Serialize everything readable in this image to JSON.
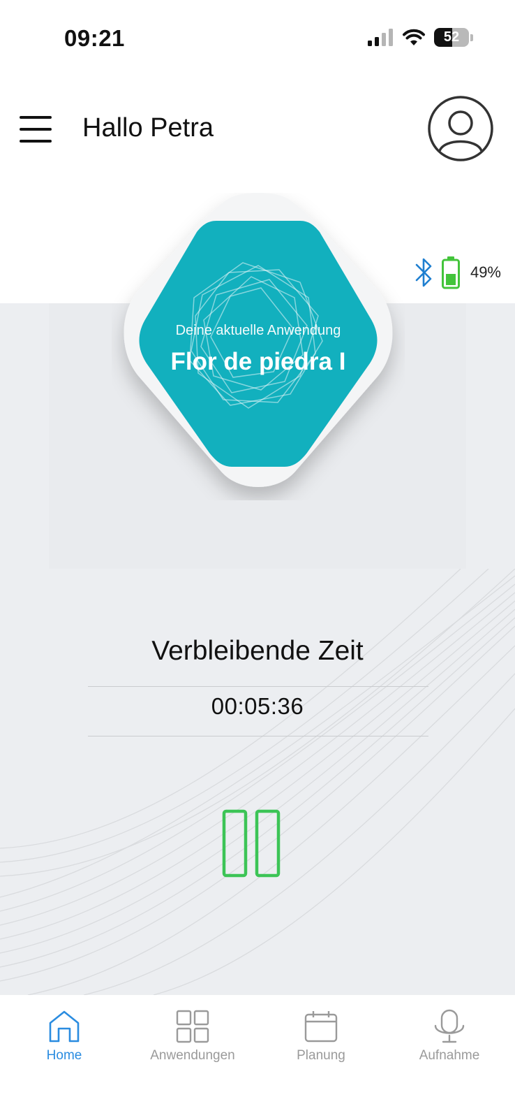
{
  "status_bar": {
    "time": "09:21",
    "battery_level": "52"
  },
  "header": {
    "greeting": "Hallo Petra",
    "menu_icon": "hamburger-icon",
    "profile_icon": "user-avatar-icon"
  },
  "device": {
    "bluetooth_icon": "bluetooth-icon",
    "battery_icon": "battery-icon",
    "battery_percent": "49%",
    "battery_color": "#43c43b"
  },
  "current_application": {
    "subtitle": "Deine aktuelle Anwendung",
    "title": "Flor de piedra I",
    "accent_color": "#12b0be"
  },
  "timer": {
    "label": "Verbleibende Zeit",
    "value": "00:05:36"
  },
  "controls": {
    "pause_icon": "pause-icon",
    "pause_color": "#3cc456"
  },
  "tabbar": {
    "tabs": [
      {
        "label": "Home",
        "icon": "home-icon",
        "active": true
      },
      {
        "label": "Anwendungen",
        "icon": "grid-icon",
        "active": false
      },
      {
        "label": "Planung",
        "icon": "calendar-icon",
        "active": false
      },
      {
        "label": "Aufnahme",
        "icon": "microphone-icon",
        "active": false
      }
    ],
    "active_color": "#2a8ce0",
    "inactive_color": "#9a9a9a"
  }
}
